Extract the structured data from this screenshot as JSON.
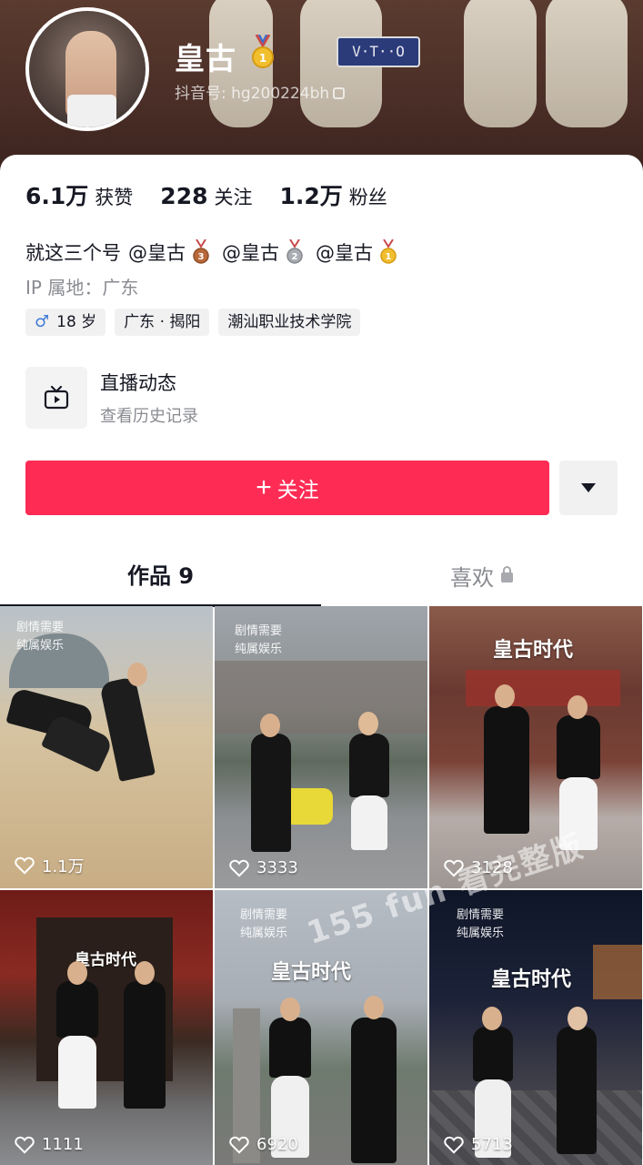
{
  "profile": {
    "name": "皇古",
    "douyin_id": "抖音号: hg200224bh",
    "cover_plate_text": "V·T··O",
    "badge_icon": "gold-medal-1"
  },
  "stats": [
    {
      "value": "6.1万",
      "label": "获赞"
    },
    {
      "value": "228",
      "label": "关注"
    },
    {
      "value": "1.2万",
      "label": "粉丝"
    }
  ],
  "bio": {
    "prefix": "就这三个号",
    "mentions": [
      "@皇古",
      "@皇古",
      "@皇古"
    ],
    "medals": [
      "bronze-3",
      "silver-2",
      "gold-1"
    ],
    "ip": "IP 属地：广东"
  },
  "tags": [
    {
      "icon": "male-icon",
      "text": "18 岁"
    },
    {
      "text": "广东 · 揭阳"
    },
    {
      "text": "潮汕职业技术学院"
    }
  ],
  "live": {
    "title": "直播动态",
    "subtitle": "查看历史记录"
  },
  "actions": {
    "follow_label": "关注",
    "follow_plus": "+",
    "colors": {
      "follow_bg": "#fe2c55",
      "more_bg": "#f1f1f2"
    }
  },
  "tabs": [
    {
      "label": "作品 9",
      "active": true
    },
    {
      "label": "喜欢",
      "active": false,
      "locked": true
    }
  ],
  "videos": [
    {
      "labels": [
        "剧情需要",
        "纯属娱乐"
      ],
      "title": "",
      "likes": "1.1万"
    },
    {
      "labels": [
        "剧情需要",
        "纯属娱乐"
      ],
      "title": "",
      "likes": "3333"
    },
    {
      "labels": [],
      "title": "皇古时代",
      "likes": "3128"
    },
    {
      "labels": [],
      "title": "皇古时代",
      "likes": "1111"
    },
    {
      "labels": [
        "剧情需要",
        "纯属娱乐"
      ],
      "title": "皇古时代",
      "likes": "6920"
    },
    {
      "labels": [
        "剧情需要",
        "纯属娱乐"
      ],
      "title": "皇古时代",
      "likes": "5713"
    }
  ],
  "watermark": "155 fun 看完整版"
}
